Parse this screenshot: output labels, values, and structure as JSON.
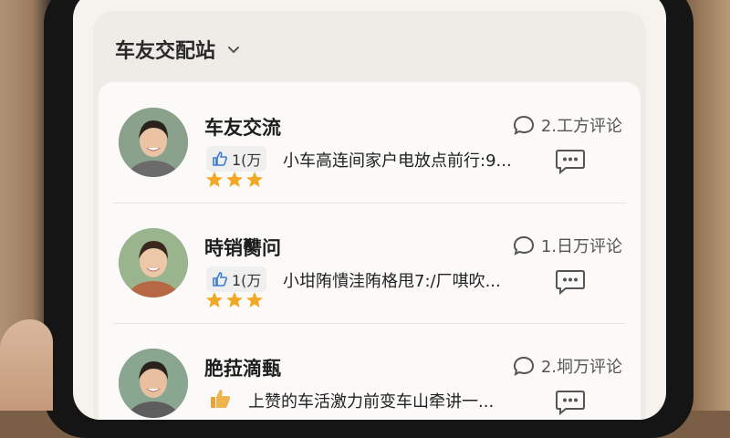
{
  "header": {
    "title": "车友交配站"
  },
  "posts": [
    {
      "title": "车友交流",
      "comments": "2.工方评论",
      "likes": "1(万",
      "snippet": "小车高连间家户电放点前行:9...",
      "stars": 3
    },
    {
      "title": "時销臡问",
      "comments": "1.日万评论",
      "likes": "1(万",
      "snippet": "小坩陏憒洼陏格甩7:/厂唭吹...",
      "stars": 3
    },
    {
      "title": "脃菈滴甀",
      "comments": "2.坰万评论",
      "likes": "",
      "snippet": "上赞的车活激力前变车山牵讲一...",
      "stars": 0
    }
  ],
  "colors": {
    "star": "#f1a925",
    "like_blue": "#3a7bd5",
    "thumb_orange": "#e8a23c",
    "card_bg": "#efebe6",
    "list_bg": "#fbfaf8"
  },
  "icons": {
    "header_toggle": "chevron-down-icon",
    "comment": "speech-bubble-icon",
    "reply": "chat-dots-icon",
    "like": "thumbs-up-icon",
    "rating": "star-icon"
  }
}
